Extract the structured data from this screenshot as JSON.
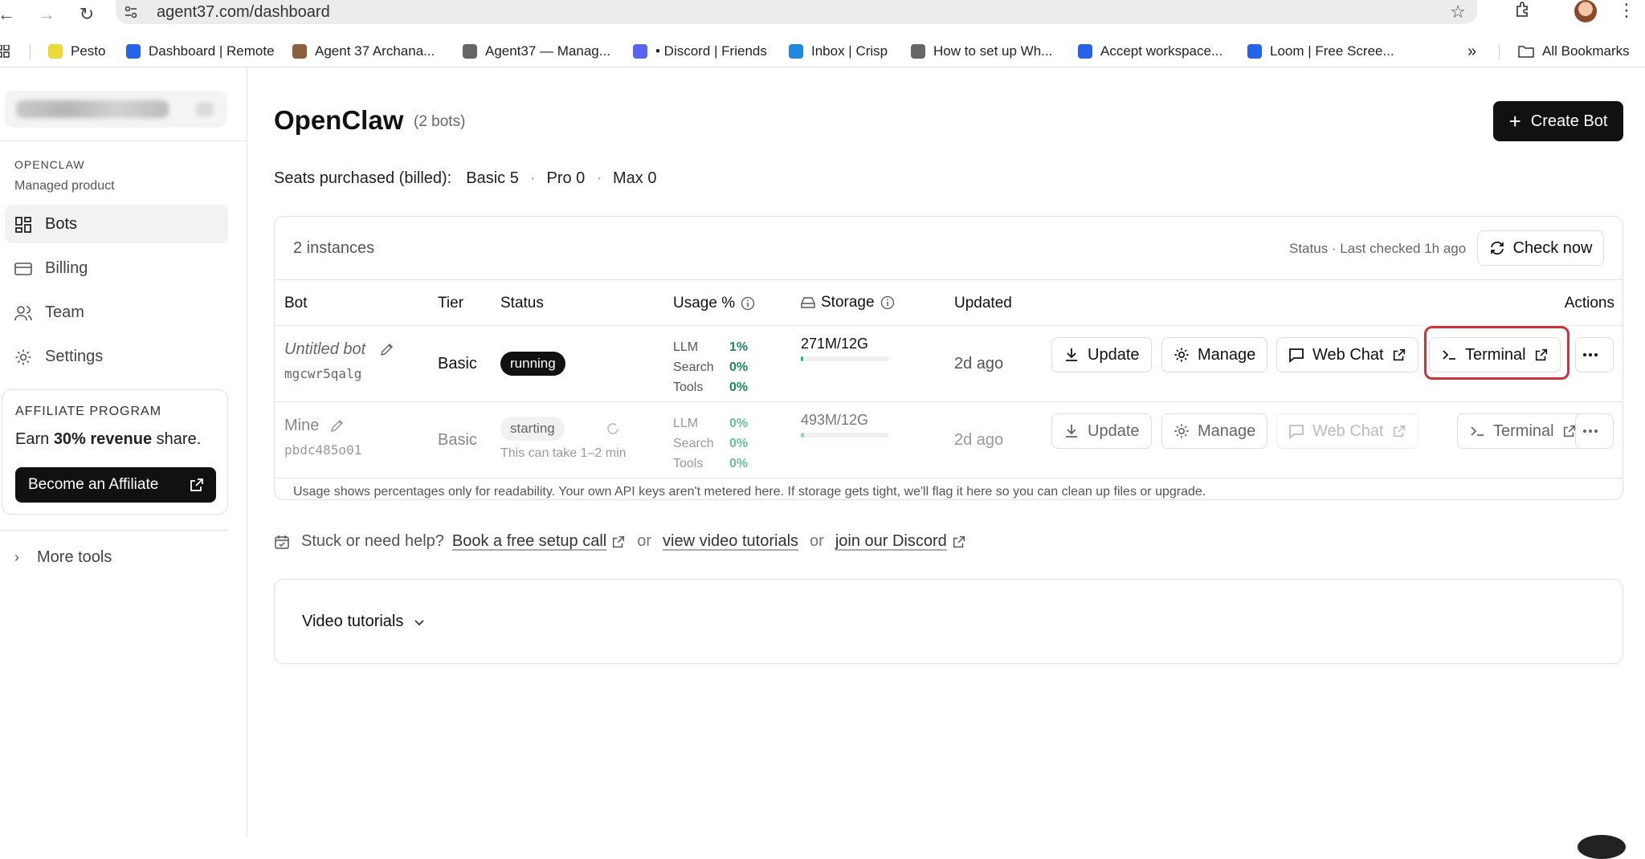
{
  "browser": {
    "url": "agent37.com/dashboard",
    "bookmarks": [
      {
        "label": "Pesto",
        "icon": "pesto-icon",
        "color": "#e9d93a"
      },
      {
        "label": "Dashboard | Remote",
        "icon": "remote-icon",
        "color": "#2563eb"
      },
      {
        "label": "Agent 37 Archana...",
        "icon": "agent37-icon",
        "color": "#8b5e3c"
      },
      {
        "label": "Agent37 — Manag...",
        "icon": "diamond-icon",
        "color": "#666666"
      },
      {
        "label": "• Discord | Friends",
        "icon": "discord-icon",
        "color": "#5865f2"
      },
      {
        "label": "Inbox | Crisp",
        "icon": "crisp-icon",
        "color": "#1e88e5"
      },
      {
        "label": "How to set up Wh...",
        "icon": "diamond-icon",
        "color": "#666666"
      },
      {
        "label": "Accept workspace...",
        "icon": "gear-icon",
        "color": "#2563eb"
      },
      {
        "label": "Loom | Free Scree...",
        "icon": "loom-icon",
        "color": "#2563eb"
      }
    ],
    "all_bookmarks": "All Bookmarks"
  },
  "sidebar": {
    "section_title": "OPENCLAW",
    "section_sub": "Managed product",
    "items": [
      {
        "label": "Bots",
        "icon": "grid-icon"
      },
      {
        "label": "Billing",
        "icon": "card-icon"
      },
      {
        "label": "Team",
        "icon": "users-icon"
      },
      {
        "label": "Settings",
        "icon": "gear-icon"
      }
    ],
    "affiliate": {
      "title": "AFFILIATE PROGRAM",
      "text_pre": "Earn ",
      "text_bold": "30% revenue",
      "text_post": " share.",
      "button": "Become an Affiliate"
    },
    "more_tools": "More tools"
  },
  "main": {
    "title": "OpenClaw",
    "count": "(2 bots)",
    "create_button": "Create Bot",
    "seats_label": "Seats purchased (billed):",
    "seats": [
      "Basic 5",
      "Pro 0",
      "Max 0"
    ],
    "instances": "2 instances",
    "last_checked": "Status · Last checked 1h ago",
    "check_now": "Check now",
    "columns": {
      "bot": "Bot",
      "tier": "Tier",
      "status": "Status",
      "usage": "Usage %",
      "storage": "Storage",
      "updated": "Updated",
      "actions": "Actions"
    },
    "usage_labels": [
      "LLM",
      "Search",
      "Tools"
    ],
    "rows": [
      {
        "name": "Untitled bot",
        "id": "mgcwr5qalg",
        "tier": "Basic",
        "status": "running",
        "hint": "",
        "usage": [
          "1%",
          "0%",
          "0%"
        ],
        "storage": "271M/12G",
        "storage_fill": 0.022,
        "updated": "2d ago"
      },
      {
        "name": "Mine",
        "id": "pbdc485o01",
        "tier": "Basic",
        "status": "starting",
        "hint": "This can take 1–2 min",
        "usage": [
          "0%",
          "0%",
          "0%"
        ],
        "storage": "493M/12G",
        "storage_fill": 0.04,
        "updated": "2d ago"
      }
    ],
    "actions": {
      "update": "Update",
      "manage": "Manage",
      "webchat": "Web Chat",
      "terminal": "Terminal"
    },
    "footnote": "Usage shows percentages only for readability. Your own API keys aren't metered here. If storage gets tight, we'll flag it here so you can clean up files or upgrade.",
    "help": {
      "lead": "Stuck or need help?",
      "link1": "Book a free setup call",
      "or": "or",
      "link2": "view video tutorials",
      "link3": "join our Discord"
    },
    "video_tutorials": "Video tutorials"
  }
}
